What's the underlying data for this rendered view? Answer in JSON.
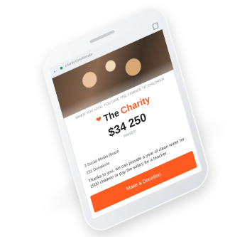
{
  "browser": {
    "back_icon": "back-arrow-icon",
    "url": "charity.com/donate",
    "tab_icon": "tab-switcher-icon"
  },
  "hero": {
    "image": "children-smiling-photo"
  },
  "page": {
    "tagline": "WHEN YOU GIVE, YOU GIVE THE CHANCE TO CHILDREN",
    "logo_part1": "The",
    "logo_part2": "Charity",
    "logo_icon": "hands-icon",
    "amount": "$34 250",
    "amount_sub": "RAISED",
    "reach": "3 Social Media Reach",
    "donations": "231 Donations",
    "thanks": "Thanks to you, we can provide a year of clean water for 1500 children or pay the salary for a teacher."
  },
  "cta": {
    "label": "Make a Donation"
  },
  "colors": {
    "accent": "#ff5a1f",
    "text": "#222222"
  }
}
